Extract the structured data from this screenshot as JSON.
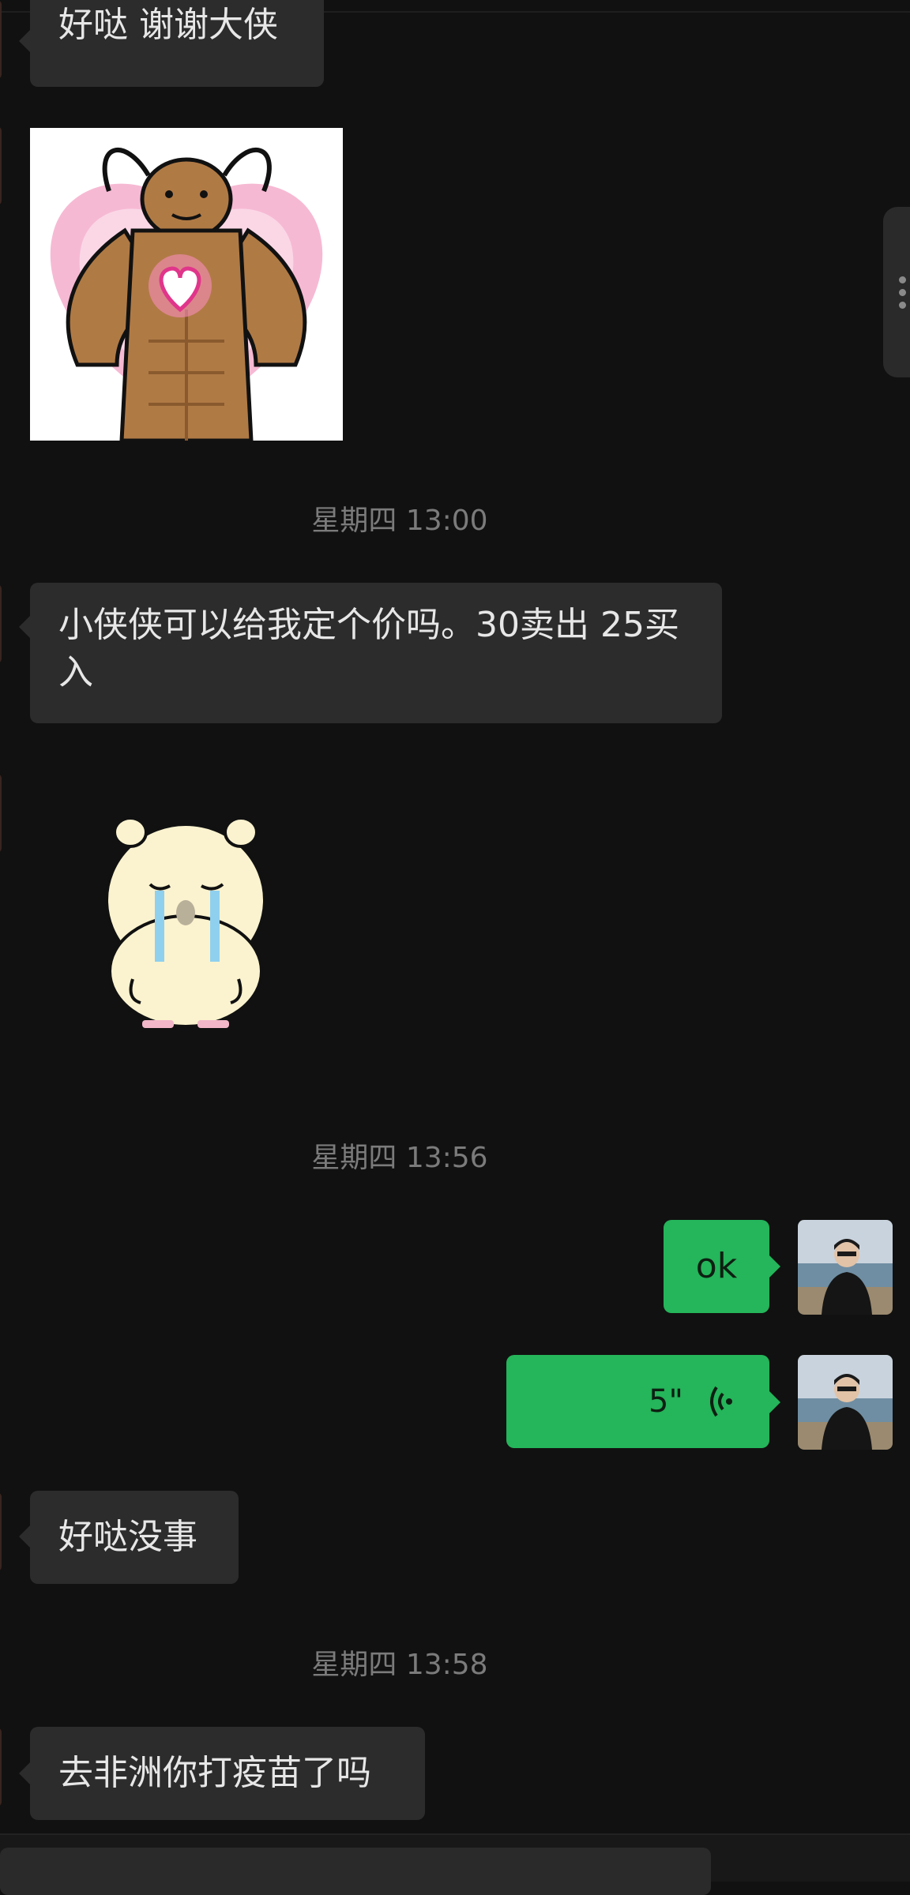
{
  "messages": {
    "m1": "好哒 谢谢大侠",
    "m2": "小侠侠可以给我定个价吗。30卖出 25买入",
    "m3": "ok",
    "m4_duration": "5\"",
    "m5": "好哒没事",
    "m6": "去非洲你打疫苗了吗"
  },
  "timestamps": {
    "t1": "星期四 13:00",
    "t2": "星期四 13:56",
    "t3": "星期四 13:58"
  },
  "colors": {
    "background": "#111111",
    "incoming_bubble": "#2c2c2c",
    "outgoing_bubble": "#25b55a",
    "timestamp": "#7b7b7b"
  },
  "icons": {
    "voice": "voice-wave-icon",
    "more": "more-dots-icon"
  }
}
